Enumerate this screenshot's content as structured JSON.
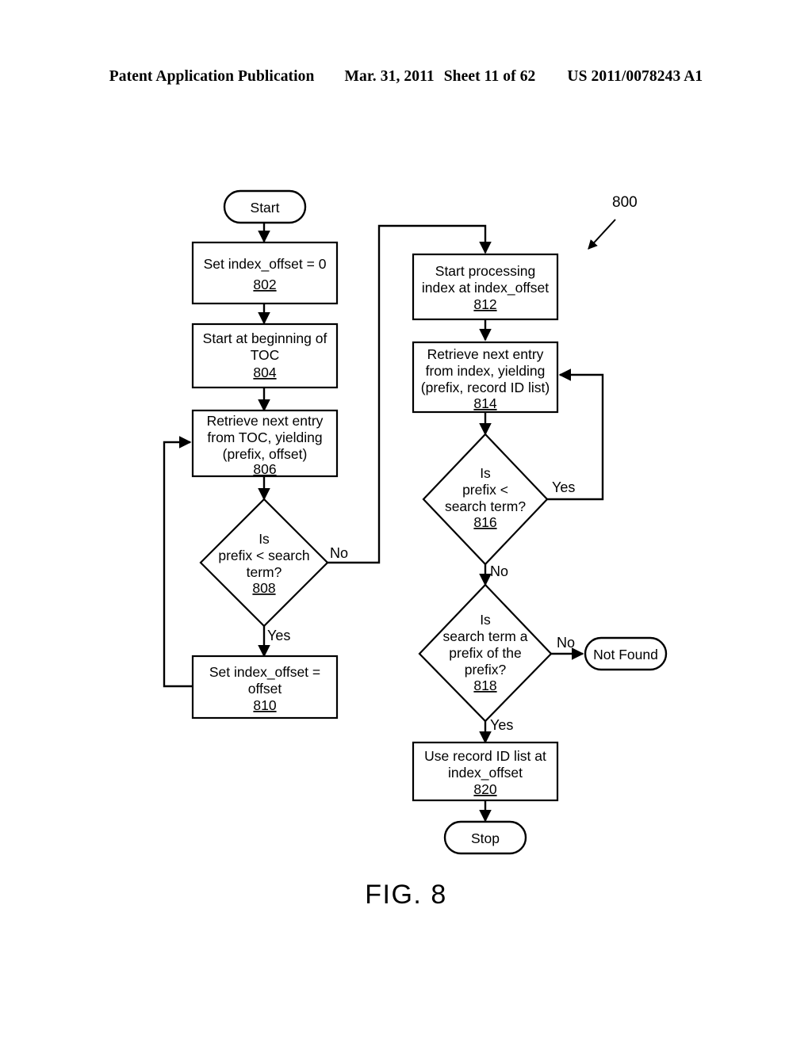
{
  "header": {
    "publication": "Patent Application Publication",
    "date": "Mar. 31, 2011",
    "sheet": "Sheet 11 of 62",
    "patent_number": "US 2011/0078243 A1"
  },
  "figure": {
    "caption": "FIG. 8",
    "reference_numeral": "800"
  },
  "flowchart": {
    "nodes": [
      {
        "id": "start",
        "type": "terminator",
        "label": "Start",
        "ref": ""
      },
      {
        "id": "n802",
        "type": "process",
        "lines": [
          "Set index_offset = 0"
        ],
        "ref": "802"
      },
      {
        "id": "n804",
        "type": "process",
        "lines": [
          "Start at beginning of",
          "TOC"
        ],
        "ref": "804"
      },
      {
        "id": "n806",
        "type": "process",
        "lines": [
          "Retrieve next entry",
          "from TOC, yielding",
          "(prefix, offset)"
        ],
        "ref": "806"
      },
      {
        "id": "n808",
        "type": "decision",
        "lines": [
          "Is",
          "prefix < search",
          "term?"
        ],
        "ref": "808"
      },
      {
        "id": "n810",
        "type": "process",
        "lines": [
          "Set index_offset =",
          "offset"
        ],
        "ref": "810"
      },
      {
        "id": "n812",
        "type": "process",
        "lines": [
          "Start processing",
          "index at index_offset"
        ],
        "ref": "812"
      },
      {
        "id": "n814",
        "type": "process",
        "lines": [
          "Retrieve next entry",
          "from index, yielding",
          "(prefix, record ID list)"
        ],
        "ref": "814"
      },
      {
        "id": "n816",
        "type": "decision",
        "lines": [
          "Is",
          "prefix <",
          "search term?"
        ],
        "ref": "816"
      },
      {
        "id": "n818",
        "type": "decision",
        "lines": [
          "Is",
          "search term a",
          "prefix of the",
          "prefix?"
        ],
        "ref": "818"
      },
      {
        "id": "n820",
        "type": "process",
        "lines": [
          "Use record ID list at",
          "index_offset"
        ],
        "ref": "820"
      },
      {
        "id": "not_found",
        "type": "terminator",
        "label": "Not Found",
        "ref": ""
      },
      {
        "id": "stop",
        "type": "terminator",
        "label": "Stop",
        "ref": ""
      }
    ],
    "edge_labels": {
      "e808_no": "No",
      "e808_yes": "Yes",
      "e816_yes": "Yes",
      "e816_no": "No",
      "e818_no": "No",
      "e818_yes": "Yes"
    }
  }
}
